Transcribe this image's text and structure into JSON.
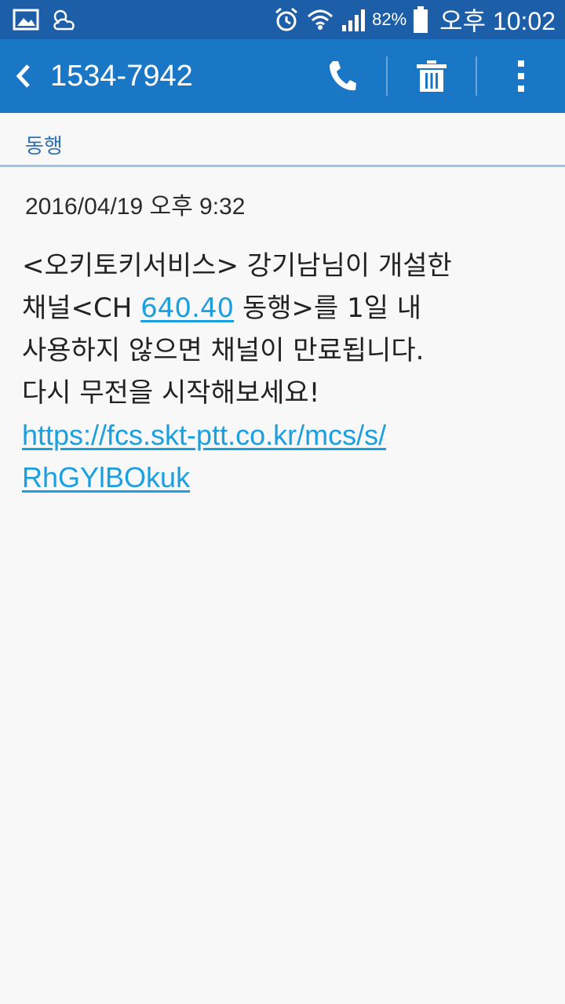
{
  "status_bar": {
    "battery_percent": "82%",
    "time": "오후 10:02"
  },
  "header": {
    "contact": "1534-7942"
  },
  "conversation": {
    "subject": "동행"
  },
  "message": {
    "timestamp": "2016/04/19  오후 9:32",
    "line1": "<오키토키서비스> 강기남님이 개설한",
    "line2_prefix": "채널<CH ",
    "channel_link": "640.40",
    "line2_suffix": " 동행>를 1일 내",
    "line3": "사용하지 않으면 채널이 만료됩니다.",
    "line4": "다시 무전을 시작해보세요!",
    "url_part1": "https://fcs.skt-ptt.co.kr/mcs/s/",
    "url_part2": "RhGYlBOkuk"
  },
  "icons": {
    "status_left": [
      "gallery-icon",
      "weather-icon"
    ],
    "status_right": [
      "alarm-icon",
      "wifi-icon",
      "signal-icon",
      "battery-icon"
    ],
    "action_bar": [
      "back-icon",
      "phone-icon",
      "trash-icon",
      "more-vert-icon"
    ]
  }
}
